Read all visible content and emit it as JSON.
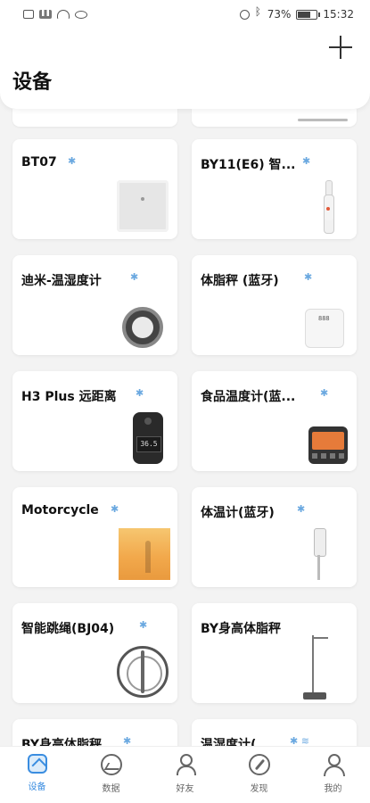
{
  "status_bar": {
    "battery": "73%",
    "battery_level": 0.73,
    "time": "15:32",
    "icons": [
      "sim-icon",
      "signal-icon",
      "wifi-icon",
      "eye-icon",
      "alarm-icon",
      "bluetooth-icon",
      "battery-icon"
    ]
  },
  "header": {
    "title": "设备",
    "add_icon": "plus-icon"
  },
  "devices": [
    {
      "name": "BT07",
      "connection": "bluetooth-icon",
      "image": "hub-icon"
    },
    {
      "name": "BY11(E6) 智...",
      "connection": "bluetooth-icon",
      "image": "toothbrush-icon"
    },
    {
      "name": "迪米-温湿度计",
      "connection": "bluetooth-icon",
      "image": "hygrometer-icon"
    },
    {
      "name": "体脂秤 (蓝牙)",
      "connection": "bluetooth-icon",
      "image": "scale-icon"
    },
    {
      "name": "H3 Plus 远距离",
      "connection": "bluetooth-icon",
      "image": "thermometer-gun-icon"
    },
    {
      "name": "食品温度计(蓝...",
      "connection": "bluetooth-icon",
      "image": "food-thermometer-icon"
    },
    {
      "name": "Motorcycle",
      "connection": "bluetooth-icon",
      "image": "motorcycle-photo"
    },
    {
      "name": "体温计(蓝牙)",
      "connection": "bluetooth-icon",
      "image": "thermometer-icon"
    },
    {
      "name": "智能跳绳(BJ04)",
      "connection": "bluetooth-icon",
      "image": "jump-rope-icon"
    },
    {
      "name": "BY身高体脂秤",
      "connection": "none",
      "image": "height-scale-icon"
    },
    {
      "name": "BY身高体脂秤",
      "connection": "bluetooth-icon",
      "image": ""
    },
    {
      "name": "温湿度计(...",
      "connection": "bluetooth-wifi-icon",
      "image": ""
    }
  ],
  "nav": {
    "active_color": "#3a8de0",
    "items": [
      {
        "label": "设备",
        "icon": "home-icon",
        "active": true
      },
      {
        "label": "数据",
        "icon": "chart-icon",
        "active": false
      },
      {
        "label": "好友",
        "icon": "friends-icon",
        "active": false
      },
      {
        "label": "发现",
        "icon": "compass-icon",
        "active": false
      },
      {
        "label": "我的",
        "icon": "profile-icon",
        "active": false
      }
    ]
  }
}
